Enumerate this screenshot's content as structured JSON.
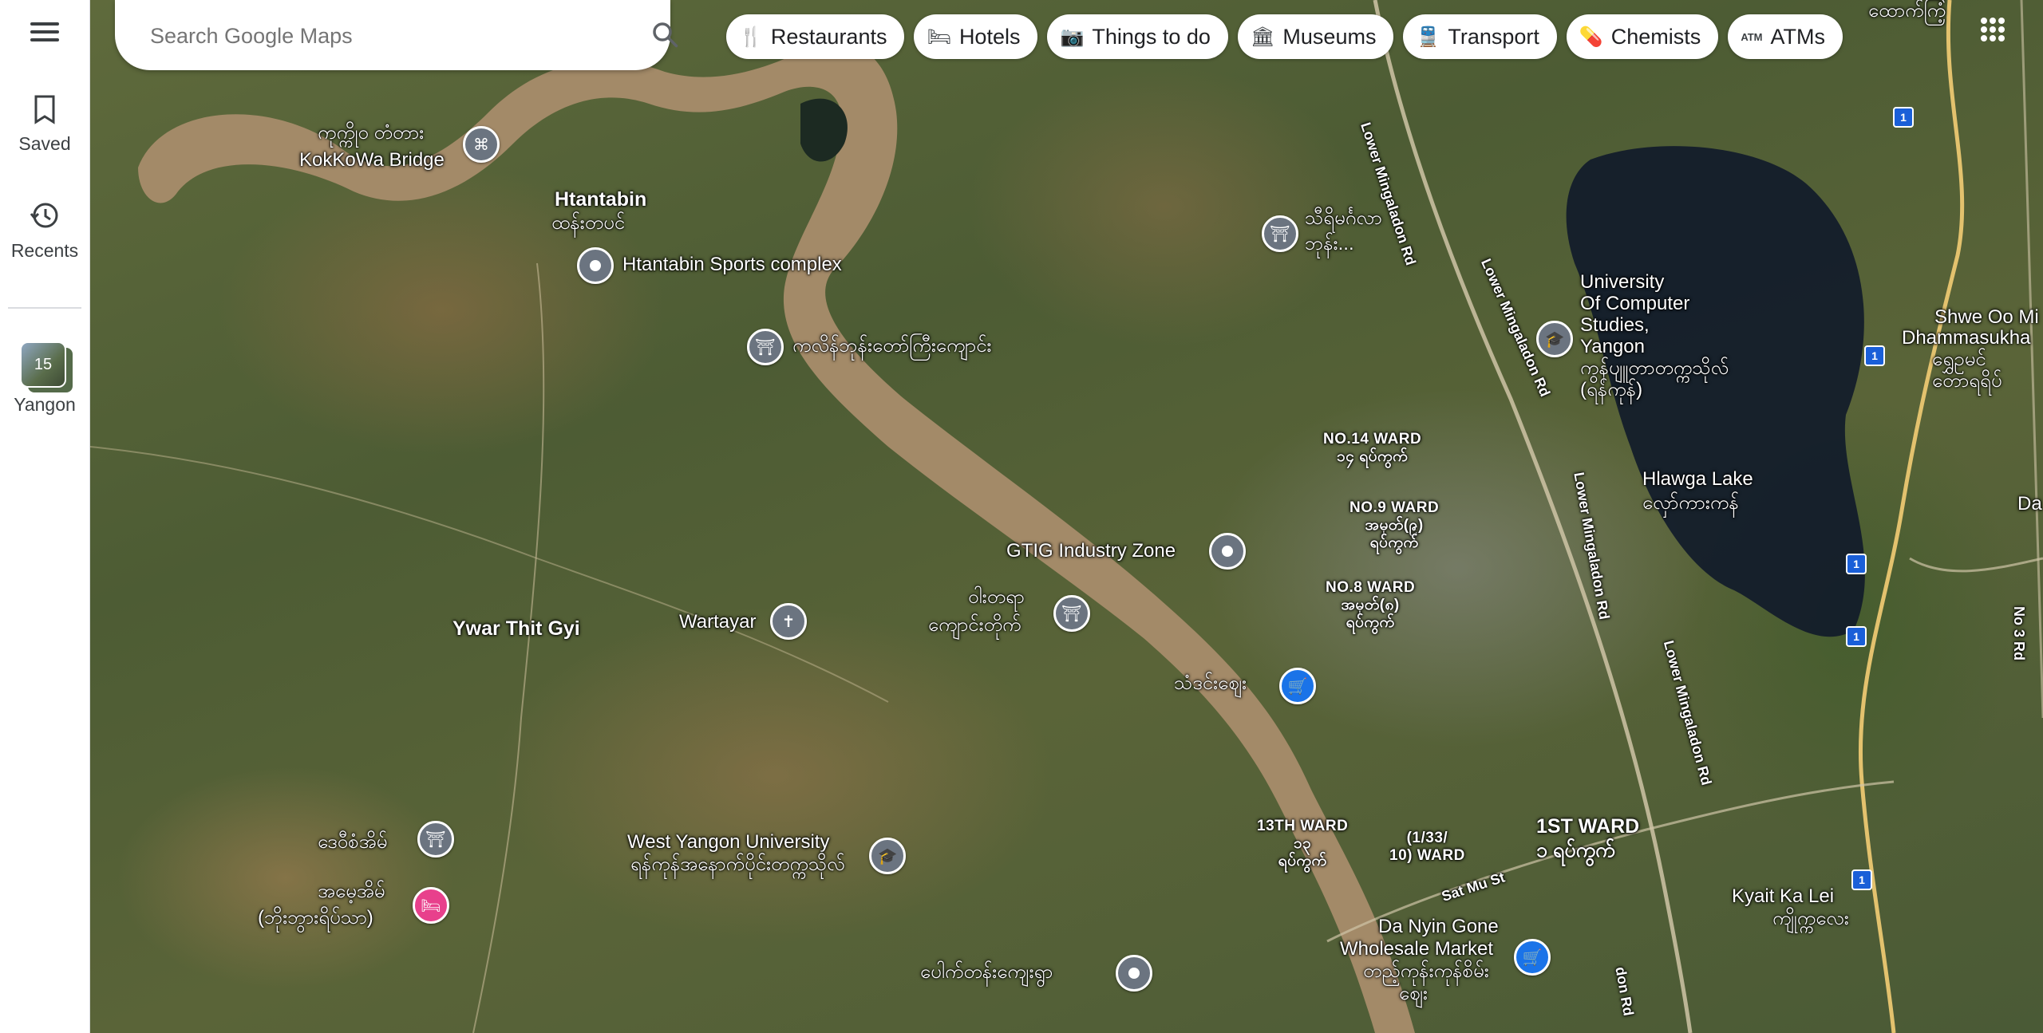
{
  "rail": {
    "saved": "Saved",
    "recents": "Recents",
    "recent_place": {
      "name": "Yangon",
      "count": "15"
    }
  },
  "search": {
    "placeholder": "Search Google Maps"
  },
  "chips": [
    {
      "label": "Restaurants",
      "icon": "fork-knife-icon"
    },
    {
      "label": "Hotels",
      "icon": "bed-icon"
    },
    {
      "label": "Things to do",
      "icon": "camera-icon"
    },
    {
      "label": "Museums",
      "icon": "museum-icon"
    },
    {
      "label": "Transport",
      "icon": "train-icon"
    },
    {
      "label": "Chemists",
      "icon": "pharmacy-icon"
    },
    {
      "label": "ATMs",
      "icon": "atm-icon"
    }
  ],
  "map": {
    "places": {
      "kokkowa_my": "ကုက္ကိုဝ တံတား",
      "kokkowa": "KokKoWa Bridge",
      "htantabin": "Htantabin",
      "htantabin_my": "ထန်းတပင်",
      "sports": "Htantabin Sports complex",
      "kalein": "ကလိန်ဘုန်းတော်ကြီးကျောင်း",
      "thiri_1": "သီရိမင်္ဂလာ",
      "thiri_2": "ဘုန်း...",
      "ucsy_1": "University",
      "ucsy_2": "Of Computer",
      "ucsy_3": "Studies,",
      "ucsy_4": "Yangon",
      "ucsy_my1": "ကွန်ပျူတာတက္ကသိုလ်",
      "ucsy_my2": "(ရန်ကုန်)",
      "shwe_1": "Shwe Oo Mi",
      "shwe_2": "Dhammasukha",
      "shwe_my1": "ရွှေဥမင်",
      "shwe_my2": "တောရရိပ်",
      "da": "Da",
      "hlawga": "Hlawga Lake",
      "hlawga_my": "လှော်ကားကန်",
      "ward14_1": "NO.14 WARD",
      "ward14_2": "၁၄ ရပ်ကွက်",
      "ward9_1": "NO.9 WARD",
      "ward9_2": "အမှတ်(၉)",
      "ward9_3": "ရပ်ကွက်",
      "ward8_1": "NO.8 WARD",
      "ward8_2": "အမှတ်(၈)",
      "ward8_3": "ရပ်ကွက်",
      "gtig": "GTIG Industry Zone",
      "ywar": "Ywar Thit Gyi",
      "wartayar": "Wartayar",
      "watayar_1": "ဝါးတရာ",
      "watayar_2": "ကျောင်းတိုက်",
      "market": "သံဒင်းဈေး",
      "ward13_1": "13TH WARD",
      "ward13_2": "၁၃",
      "ward13_3": "ရပ်ကွက်",
      "ward1_33_1": "(1/33/",
      "ward1_33_2": "10) WARD",
      "ward1st_1": "1ST WARD",
      "ward1st_2": "၁ ရပ်ကွက်",
      "dezi": "ဒေဝီစံအိမ်",
      "amay_1": "အမေ့အိမ်",
      "amay_2": "(ဘိုးဘွားရိပ်သာ)",
      "wyu": "West Yangon University",
      "wyu_my": "ရန်ကုန်အနောက်ပိုင်းတက္ကသိုလ်",
      "paukt": "ပေါက်တန်းကျေးရွာ",
      "danyin_1": "Da Nyin Gone",
      "danyin_2": "Wholesale Market",
      "danyin_3": "တည့်ကုန်းကုန်စိမ်း",
      "danyin_4": "ဈေး",
      "kyait_1": "Kyait Ka Lei",
      "kyait_2": "ကျိုက္ကလေး",
      "top_right": "ထောက်ကြံ့"
    },
    "roads": {
      "lower_mingaladon": "Lower Mingaladon Rd",
      "sat_mu": "Sat Mu St",
      "no3": "No 3 Rd",
      "don": "don Rd"
    },
    "route_shield": "1"
  },
  "colors": {
    "accent": "#1a73e8",
    "pin_gray": "#6b7480",
    "pin_pink": "#e8408c",
    "river": "#a38a68"
  }
}
